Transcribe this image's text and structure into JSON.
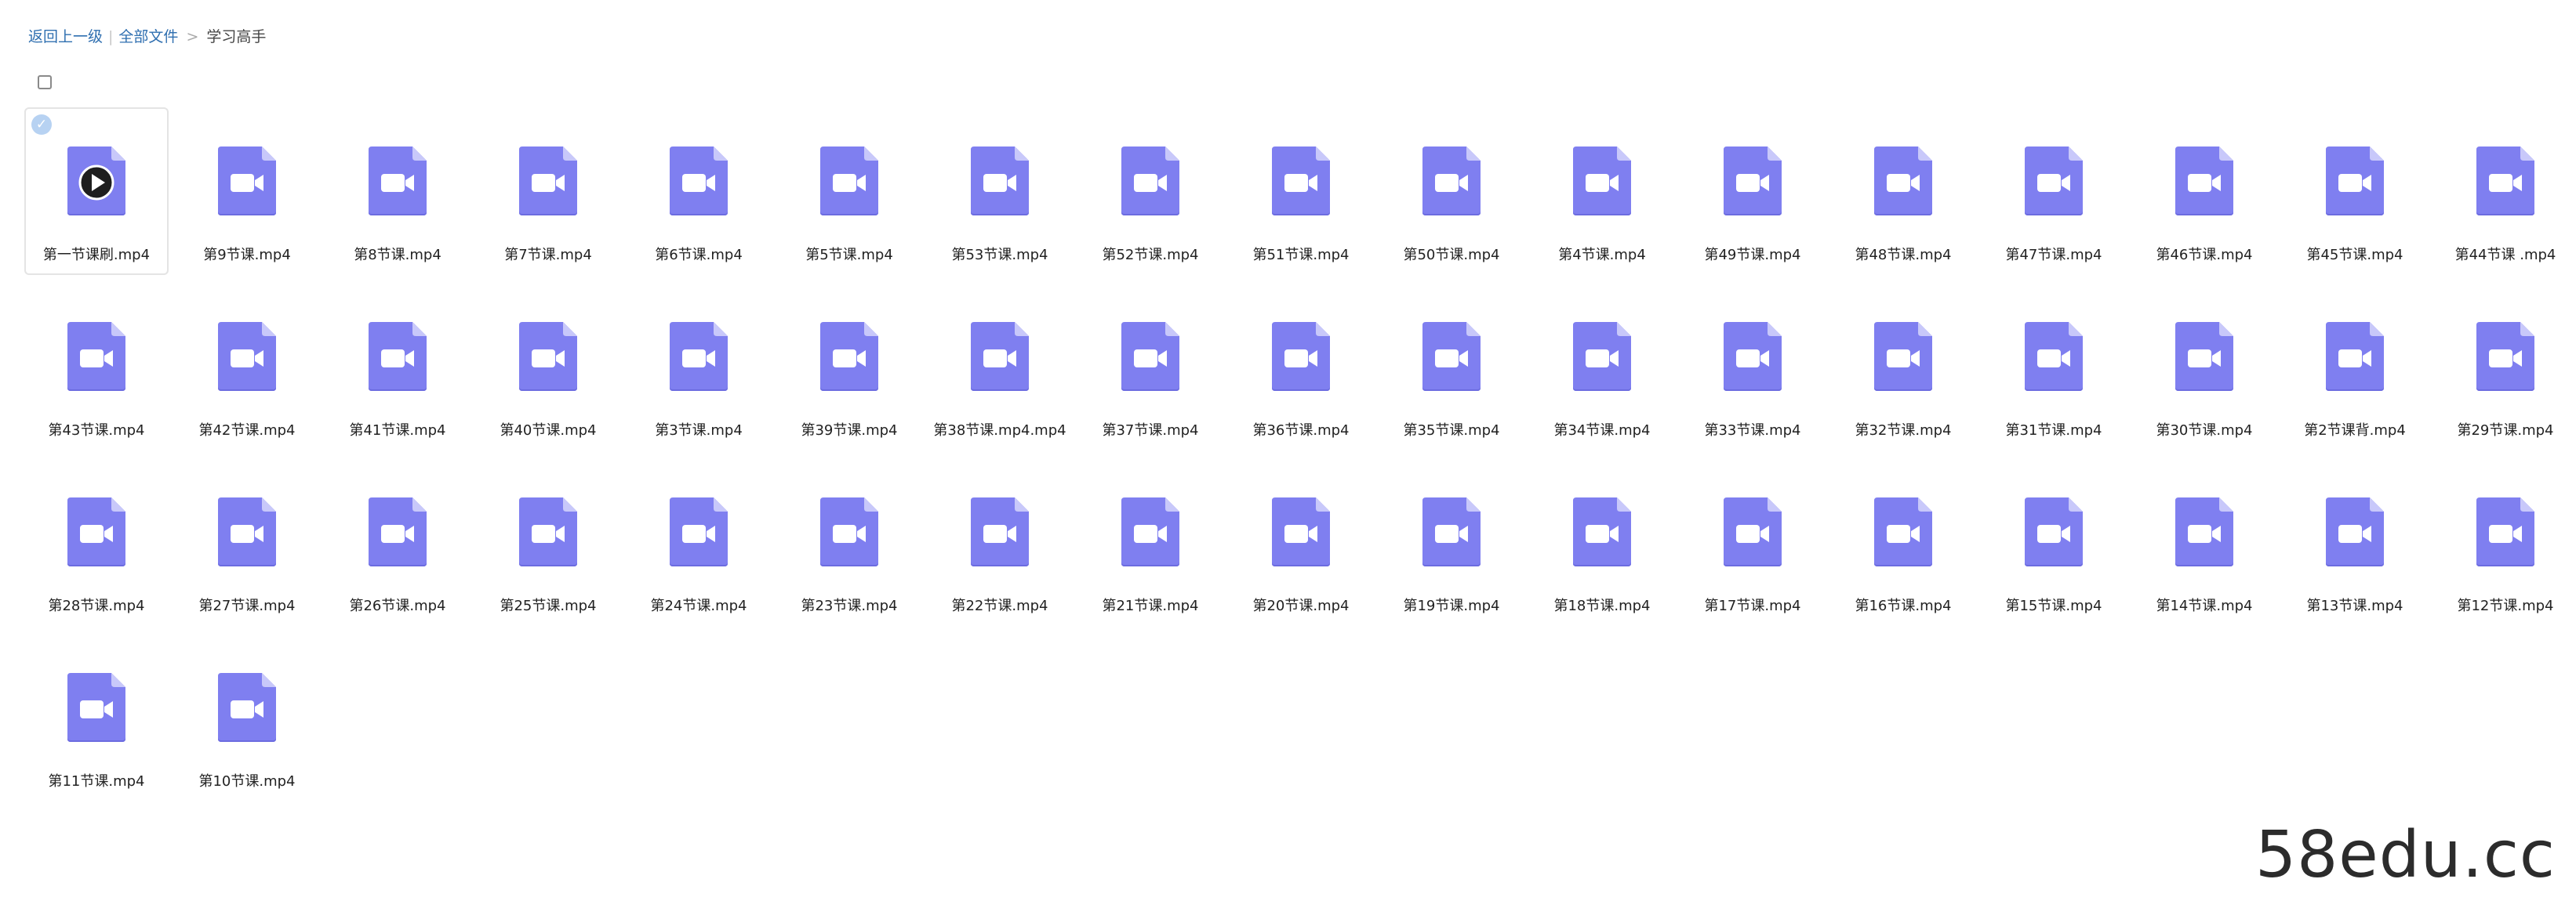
{
  "breadcrumb": {
    "back": "返回上一级",
    "separator": "|",
    "all_files": "全部文件",
    "arrow": ">",
    "current": "学习高手"
  },
  "colors": {
    "file_icon": "#7f7ff0",
    "file_icon_fold": "#c8c8fa",
    "file_icon_edge": "#6c6ce0",
    "link": "#2f6fb0",
    "check": "#b7d2f2"
  },
  "check_glyph": "✓",
  "files": [
    {
      "name": "第一节课刷.mp4",
      "icon": "video-play-icon",
      "selected": true
    },
    {
      "name": "第9节课.mp4",
      "icon": "video-file-icon"
    },
    {
      "name": "第8节课.mp4",
      "icon": "video-file-icon"
    },
    {
      "name": "第7节课.mp4",
      "icon": "video-file-icon"
    },
    {
      "name": "第6节课.mp4",
      "icon": "video-file-icon"
    },
    {
      "name": "第5节课.mp4",
      "icon": "video-file-icon"
    },
    {
      "name": "第53节课.mp4",
      "icon": "video-file-icon"
    },
    {
      "name": "第52节课.mp4",
      "icon": "video-file-icon"
    },
    {
      "name": "第51节课.mp4",
      "icon": "video-file-icon"
    },
    {
      "name": "第50节课.mp4",
      "icon": "video-file-icon"
    },
    {
      "name": "第4节课.mp4",
      "icon": "video-file-icon"
    },
    {
      "name": "第49节课.mp4",
      "icon": "video-file-icon"
    },
    {
      "name": "第48节课.mp4",
      "icon": "video-file-icon"
    },
    {
      "name": "第47节课.mp4",
      "icon": "video-file-icon"
    },
    {
      "name": "第46节课.mp4",
      "icon": "video-file-icon"
    },
    {
      "name": "第45节课.mp4",
      "icon": "video-file-icon"
    },
    {
      "name": "第44节课 .mp4",
      "icon": "video-file-icon"
    },
    {
      "name": "第43节课.mp4",
      "icon": "video-file-icon"
    },
    {
      "name": "第42节课.mp4",
      "icon": "video-file-icon"
    },
    {
      "name": "第41节课.mp4",
      "icon": "video-file-icon"
    },
    {
      "name": "第40节课.mp4",
      "icon": "video-file-icon"
    },
    {
      "name": "第3节课.mp4",
      "icon": "video-file-icon"
    },
    {
      "name": "第39节课.mp4",
      "icon": "video-file-icon"
    },
    {
      "name": "第38节课.mp4.mp4",
      "icon": "video-file-icon"
    },
    {
      "name": "第37节课.mp4",
      "icon": "video-file-icon"
    },
    {
      "name": "第36节课.mp4",
      "icon": "video-file-icon"
    },
    {
      "name": "第35节课.mp4",
      "icon": "video-file-icon"
    },
    {
      "name": "第34节课.mp4",
      "icon": "video-file-icon"
    },
    {
      "name": "第33节课.mp4",
      "icon": "video-file-icon"
    },
    {
      "name": "第32节课.mp4",
      "icon": "video-file-icon"
    },
    {
      "name": "第31节课.mp4",
      "icon": "video-file-icon"
    },
    {
      "name": "第30节课.mp4",
      "icon": "video-file-icon"
    },
    {
      "name": "第2节课背.mp4",
      "icon": "video-file-icon"
    },
    {
      "name": "第29节课.mp4",
      "icon": "video-file-icon"
    },
    {
      "name": "第28节课.mp4",
      "icon": "video-file-icon"
    },
    {
      "name": "第27节课.mp4",
      "icon": "video-file-icon"
    },
    {
      "name": "第26节课.mp4",
      "icon": "video-file-icon"
    },
    {
      "name": "第25节课.mp4",
      "icon": "video-file-icon"
    },
    {
      "name": "第24节课.mp4",
      "icon": "video-file-icon"
    },
    {
      "name": "第23节课.mp4",
      "icon": "video-file-icon"
    },
    {
      "name": "第22节课.mp4",
      "icon": "video-file-icon"
    },
    {
      "name": "第21节课.mp4",
      "icon": "video-file-icon"
    },
    {
      "name": "第20节课.mp4",
      "icon": "video-file-icon"
    },
    {
      "name": "第19节课.mp4",
      "icon": "video-file-icon"
    },
    {
      "name": "第18节课.mp4",
      "icon": "video-file-icon"
    },
    {
      "name": "第17节课.mp4",
      "icon": "video-file-icon"
    },
    {
      "name": "第16节课.mp4",
      "icon": "video-file-icon"
    },
    {
      "name": "第15节课.mp4",
      "icon": "video-file-icon"
    },
    {
      "name": "第14节课.mp4",
      "icon": "video-file-icon"
    },
    {
      "name": "第13节课.mp4",
      "icon": "video-file-icon"
    },
    {
      "name": "第12节课.mp4",
      "icon": "video-file-icon"
    },
    {
      "name": "第11节课.mp4",
      "icon": "video-file-icon"
    },
    {
      "name": "第10节课.mp4",
      "icon": "video-file-icon"
    }
  ],
  "watermark": "58edu.cc"
}
